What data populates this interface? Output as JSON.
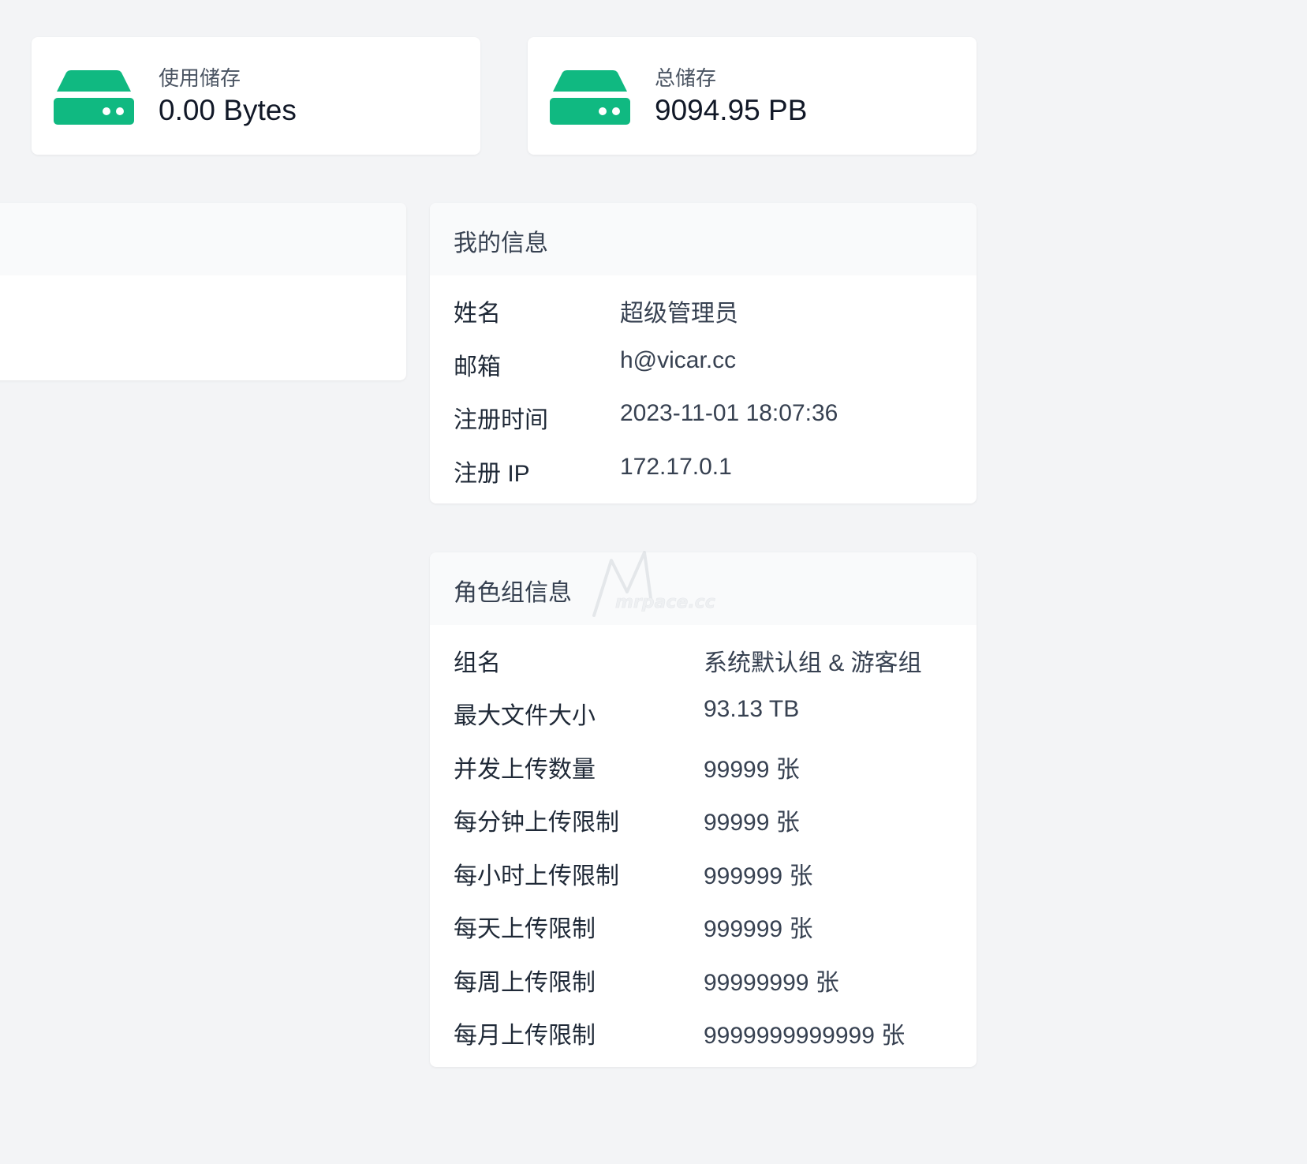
{
  "stats": {
    "used": {
      "label": "使用储存",
      "value": "0.00 Bytes",
      "icon": "hard-drive-icon"
    },
    "total": {
      "label": "总储存",
      "value": "9094.95 PB",
      "icon": "hard-drive-icon"
    }
  },
  "colors": {
    "accent": "#10b981",
    "background": "#f3f4f6",
    "card": "#ffffff",
    "card_header": "#f9fafb"
  },
  "my_info": {
    "title": "我的信息",
    "rows": [
      {
        "label": "姓名",
        "value": "超级管理员"
      },
      {
        "label": "邮箱",
        "value": "h@vicar.cc"
      },
      {
        "label": "注册时间",
        "value": "2023-11-01 18:07:36"
      },
      {
        "label": "注册 IP",
        "value": "172.17.0.1"
      }
    ]
  },
  "role_info": {
    "title": "角色组信息",
    "rows": [
      {
        "label": "组名",
        "value": "系统默认组 & 游客组"
      },
      {
        "label": "最大文件大小",
        "value": "93.13 TB"
      },
      {
        "label": "并发上传数量",
        "value": "99999 张"
      },
      {
        "label": "每分钟上传限制",
        "value": "99999 张"
      },
      {
        "label": "每小时上传限制",
        "value": "999999 张"
      },
      {
        "label": "每天上传限制",
        "value": "999999 张"
      },
      {
        "label": "每周上传限制",
        "value": "99999999 张"
      },
      {
        "label": "每月上传限制",
        "value": "9999999999999 张"
      }
    ]
  },
  "watermark": {
    "text": "mrpace.cc"
  }
}
